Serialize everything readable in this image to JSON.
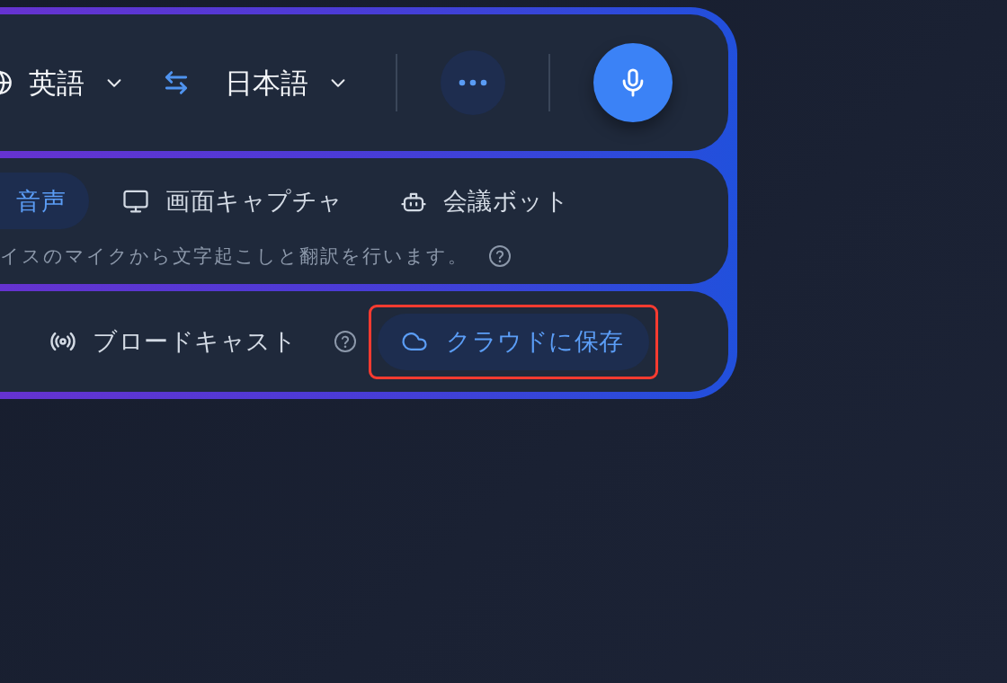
{
  "language_bar": {
    "source_language": "英語",
    "target_language": "日本語"
  },
  "input_modes": [
    {
      "label": "音声",
      "selected": true
    },
    {
      "label": "画面キャプチャ",
      "selected": false
    },
    {
      "label": "会議ボット",
      "selected": false
    }
  ],
  "mode_description": {
    "text": "イスのマイクから文字起こしと翻訳を行います。",
    "help": true
  },
  "output_options": [
    {
      "label": "ブロードキャスト",
      "selected": false,
      "help": true,
      "highlighted": false
    },
    {
      "label": "クラウドに保存",
      "selected": true,
      "help": false,
      "highlighted": true
    }
  ]
}
